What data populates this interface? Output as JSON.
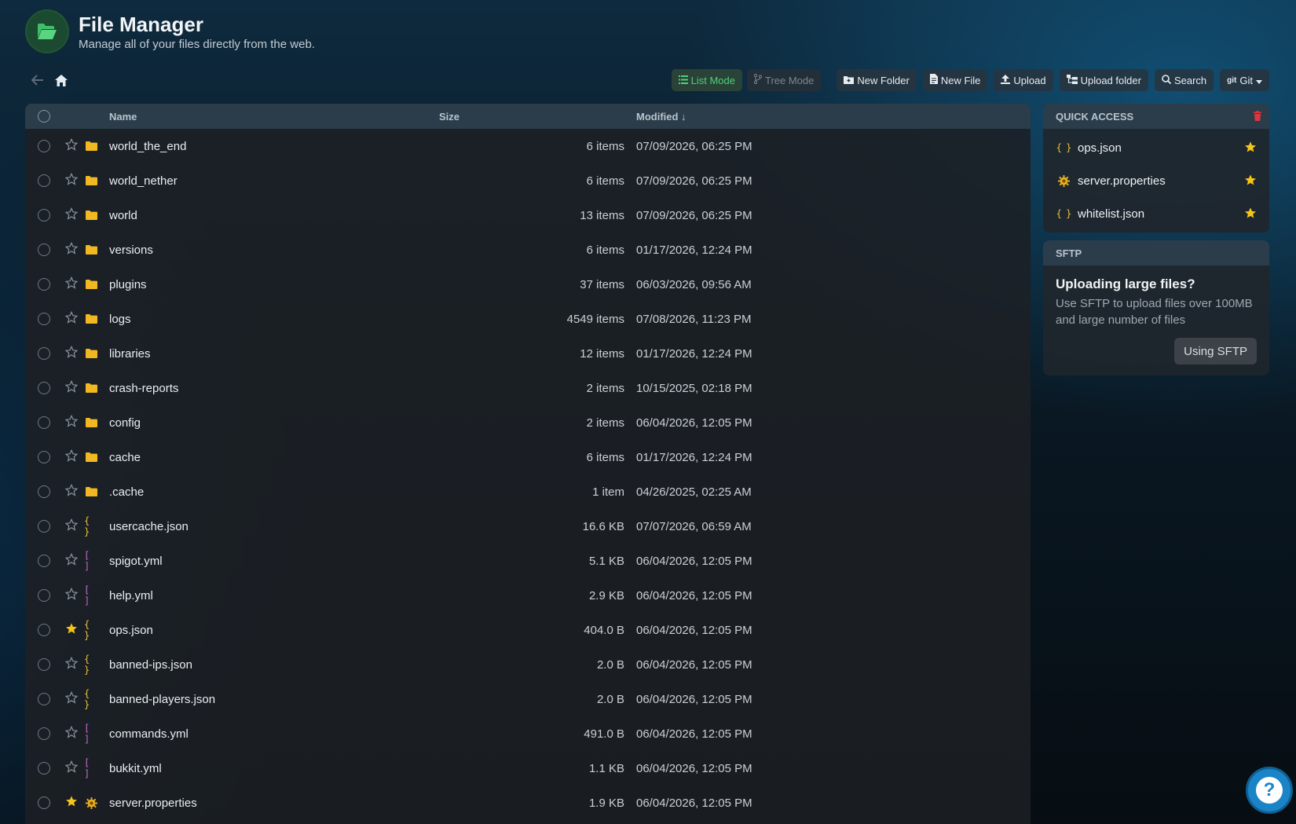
{
  "header": {
    "title": "File Manager",
    "subtitle": "Manage all of your files directly from the web."
  },
  "toolbar": {
    "list_mode": "List Mode",
    "tree_mode": "Tree Mode",
    "new_folder": "New Folder",
    "new_file": "New File",
    "upload": "Upload",
    "upload_folder": "Upload folder",
    "search": "Search",
    "git": "Git"
  },
  "table": {
    "columns": {
      "name": "Name",
      "size": "Size",
      "modified": "Modified ↓"
    },
    "rows": [
      {
        "name": "world_the_end",
        "size": "6 items",
        "modified": "07/09/2026, 06:25 PM",
        "type": "folder",
        "starred": false
      },
      {
        "name": "world_nether",
        "size": "6 items",
        "modified": "07/09/2026, 06:25 PM",
        "type": "folder",
        "starred": false
      },
      {
        "name": "world",
        "size": "13 items",
        "modified": "07/09/2026, 06:25 PM",
        "type": "folder",
        "starred": false
      },
      {
        "name": "versions",
        "size": "6 items",
        "modified": "01/17/2026, 12:24 PM",
        "type": "folder",
        "starred": false
      },
      {
        "name": "plugins",
        "size": "37 items",
        "modified": "06/03/2026, 09:56 AM",
        "type": "folder",
        "starred": false
      },
      {
        "name": "logs",
        "size": "4549 items",
        "modified": "07/08/2026, 11:23 PM",
        "type": "folder",
        "starred": false
      },
      {
        "name": "libraries",
        "size": "12 items",
        "modified": "01/17/2026, 12:24 PM",
        "type": "folder",
        "starred": false
      },
      {
        "name": "crash-reports",
        "size": "2 items",
        "modified": "10/15/2025, 02:18 PM",
        "type": "folder",
        "starred": false
      },
      {
        "name": "config",
        "size": "2 items",
        "modified": "06/04/2026, 12:05 PM",
        "type": "folder",
        "starred": false
      },
      {
        "name": "cache",
        "size": "6 items",
        "modified": "01/17/2026, 12:24 PM",
        "type": "folder",
        "starred": false
      },
      {
        "name": ".cache",
        "size": "1 item",
        "modified": "04/26/2025, 02:25 AM",
        "type": "folder",
        "starred": false
      },
      {
        "name": "usercache.json",
        "size": "16.6 KB",
        "modified": "07/07/2026, 06:59 AM",
        "type": "json",
        "starred": false
      },
      {
        "name": "spigot.yml",
        "size": "5.1 KB",
        "modified": "06/04/2026, 12:05 PM",
        "type": "yml",
        "starred": false
      },
      {
        "name": "help.yml",
        "size": "2.9 KB",
        "modified": "06/04/2026, 12:05 PM",
        "type": "yml",
        "starred": false
      },
      {
        "name": "ops.json",
        "size": "404.0 B",
        "modified": "06/04/2026, 12:05 PM",
        "type": "json",
        "starred": true
      },
      {
        "name": "banned-ips.json",
        "size": "2.0 B",
        "modified": "06/04/2026, 12:05 PM",
        "type": "json",
        "starred": false
      },
      {
        "name": "banned-players.json",
        "size": "2.0 B",
        "modified": "06/04/2026, 12:05 PM",
        "type": "json",
        "starred": false
      },
      {
        "name": "commands.yml",
        "size": "491.0 B",
        "modified": "06/04/2026, 12:05 PM",
        "type": "yml",
        "starred": false
      },
      {
        "name": "bukkit.yml",
        "size": "1.1 KB",
        "modified": "06/04/2026, 12:05 PM",
        "type": "yml",
        "starred": false
      },
      {
        "name": "server.properties",
        "size": "1.9 KB",
        "modified": "06/04/2026, 12:05 PM",
        "type": "properties",
        "starred": true
      }
    ]
  },
  "quick_access": {
    "title": "QUICK ACCESS",
    "items": [
      {
        "name": "ops.json",
        "type": "json"
      },
      {
        "name": "server.properties",
        "type": "properties"
      },
      {
        "name": "whitelist.json",
        "type": "json"
      }
    ]
  },
  "sftp": {
    "header": "SFTP",
    "title": "Uploading large files?",
    "text": "Use SFTP to upload files over 100MB and large number of files",
    "button": "Using SFTP"
  },
  "help": {
    "label": "?"
  },
  "colors": {
    "folder": "#f2b822",
    "json": "#e8c23a",
    "yml": "#c86ad1",
    "star": "#f5c518",
    "accent_green": "#4ed07a",
    "help_blue": "#1b84c7",
    "delete_red": "#d9363e"
  }
}
